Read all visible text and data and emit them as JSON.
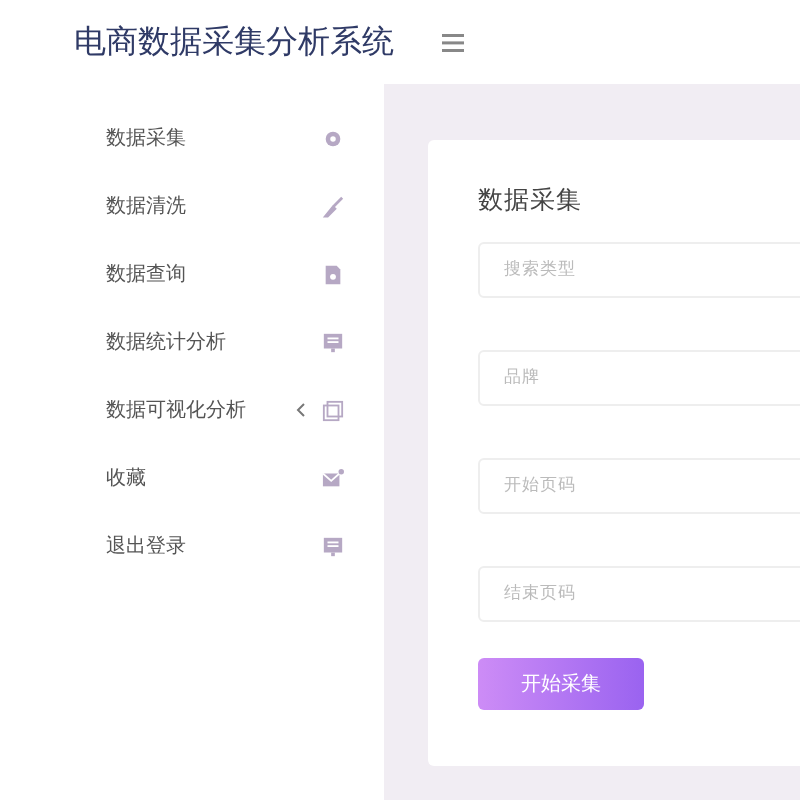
{
  "app_title": "电商数据采集分析系统",
  "sidebar": {
    "items": [
      {
        "label": "数据采集",
        "submenu": false
      },
      {
        "label": "数据清洗",
        "submenu": false
      },
      {
        "label": "数据查询",
        "submenu": false
      },
      {
        "label": "数据统计分析",
        "submenu": false
      },
      {
        "label": "数据可视化分析",
        "submenu": true
      },
      {
        "label": "收藏",
        "submenu": false
      },
      {
        "label": "退出登录",
        "submenu": false
      }
    ]
  },
  "form": {
    "title": "数据采集",
    "fields": [
      {
        "placeholder": "搜索类型"
      },
      {
        "placeholder": "品牌"
      },
      {
        "placeholder": "开始页码"
      },
      {
        "placeholder": "结束页码"
      }
    ],
    "submit": "开始采集"
  }
}
